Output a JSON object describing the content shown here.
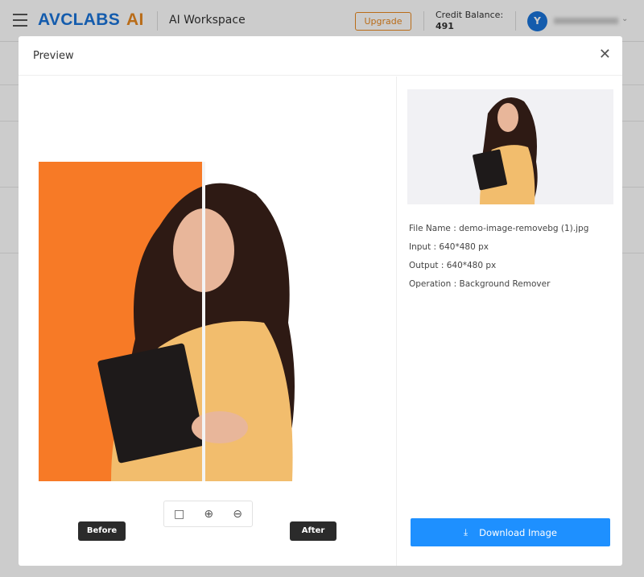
{
  "app": {
    "logo_main": "AVCLABS",
    "logo_accent": "AI",
    "workspace": "AI Workspace",
    "upgrade": "Upgrade",
    "credit_label": "Credit Balance:",
    "credit_value": "491",
    "avatar_initial": "Y"
  },
  "modal": {
    "title": "Preview",
    "before_label": "Before",
    "after_label": "After",
    "info": [
      {
        "label": "File Name",
        "value": "demo-image-removebg (1).jpg"
      },
      {
        "label": "Input",
        "value": "640*480 px"
      },
      {
        "label": "Output",
        "value": "640*480 px"
      },
      {
        "label": "Operation",
        "value": "Background Remover"
      }
    ],
    "download_label": "Download Image"
  },
  "colors": {
    "brand": "#1a73d9",
    "accent": "#e8871e",
    "download": "#1e90ff",
    "before_bg": "#f77a26"
  },
  "icons": [
    "menu-icon",
    "close-icon",
    "fit-screen-icon",
    "zoom-in-icon",
    "zoom-out-icon",
    "download-icon",
    "chevron-down-icon"
  ]
}
